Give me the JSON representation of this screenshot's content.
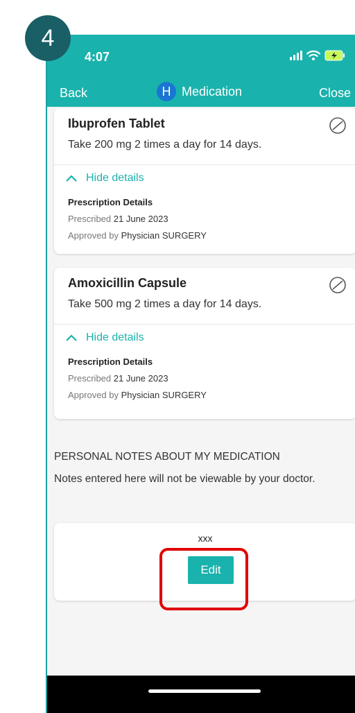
{
  "step_number": "4",
  "status_bar": {
    "time": "4:07"
  },
  "nav": {
    "back_label": "Back",
    "logo_letter": "H",
    "title": "Medication",
    "close_label": "Close"
  },
  "medications": [
    {
      "name": "Ibuprofen Tablet",
      "dose": "Take 200 mg 2 times a day for 14 days.",
      "toggle_label": "Hide details",
      "details_title": "Prescription Details",
      "prescribed_label": "Prescribed",
      "prescribed_date": "21 June 2023",
      "approved_label": "Approved by",
      "approved_by": "Physician SURGERY"
    },
    {
      "name": "Amoxicillin Capsule",
      "dose": "Take 500 mg 2 times a day for 14 days.",
      "toggle_label": "Hide details",
      "details_title": "Prescription Details",
      "prescribed_label": "Prescribed",
      "prescribed_date": "21 June 2023",
      "approved_label": "Approved by",
      "approved_by": "Physician SURGERY"
    }
  ],
  "notes": {
    "heading": "PERSONAL NOTES ABOUT MY MEDICATION",
    "description": "Notes entered here will not be viewable by your doctor.",
    "note_text": "xxx",
    "edit_label": "Edit"
  },
  "colors": {
    "accent": "#1ab2ac",
    "badge": "#1a5e66",
    "highlight": "#e00000",
    "logo": "#1976d2"
  },
  "icons": [
    "pill-icon",
    "chevron-up-icon",
    "signal-icon",
    "wifi-icon",
    "battery-charging-icon"
  ]
}
